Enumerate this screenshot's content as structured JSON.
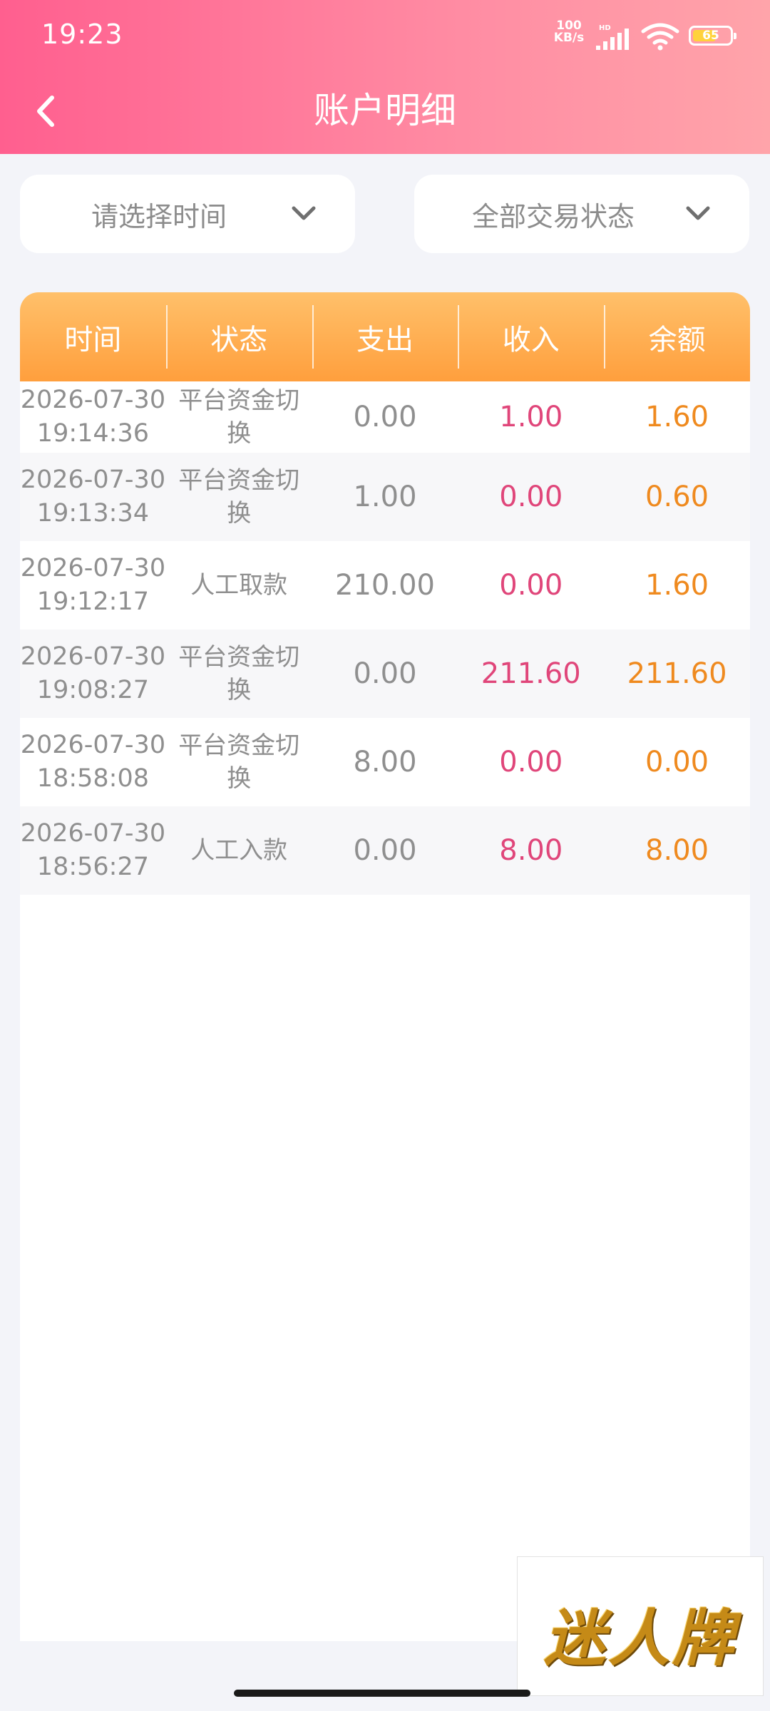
{
  "status_bar": {
    "time": "19:23",
    "net_speed_value": "100",
    "net_speed_unit": "KB/s",
    "network": "HD",
    "battery": "65",
    "battery_level": 0.65
  },
  "nav": {
    "back_icon": "chevron-left-icon",
    "title": "账户明细"
  },
  "filters": {
    "time_placeholder": "请选择时间",
    "status_value": "全部交易状态",
    "dropdown_icon": "chevron-down-icon"
  },
  "table": {
    "headers": [
      "时间",
      "状态",
      "支出",
      "收入",
      "余额"
    ],
    "rows": [
      {
        "date": "2026-07-30",
        "time": "19:14:36",
        "status": "平台资金切换",
        "expense": "0.00",
        "income": "1.00",
        "balance": "1.60"
      },
      {
        "date": "2026-07-30",
        "time": "19:13:34",
        "status": "平台资金切换",
        "expense": "1.00",
        "income": "0.00",
        "balance": "0.60"
      },
      {
        "date": "2026-07-30",
        "time": "19:12:17",
        "status": "人工取款",
        "expense": "210.00",
        "income": "0.00",
        "balance": "1.60"
      },
      {
        "date": "2026-07-30",
        "time": "19:08:27",
        "status": "平台资金切换",
        "expense": "0.00",
        "income": "211.60",
        "balance": "211.60"
      },
      {
        "date": "2026-07-30",
        "time": "18:58:08",
        "status": "平台资金切换",
        "expense": "8.00",
        "income": "0.00",
        "balance": "0.00"
      },
      {
        "date": "2026-07-30",
        "time": "18:56:27",
        "status": "人工入款",
        "expense": "0.00",
        "income": "8.00",
        "balance": "8.00"
      }
    ]
  },
  "watermark": {
    "text": "迷人牌"
  },
  "colors": {
    "header_start": "#ff5f8f",
    "header_end": "#ffa4aa",
    "table_head": "#ff9f3d",
    "income": "#e0467a",
    "balance": "#ef8a1f"
  }
}
